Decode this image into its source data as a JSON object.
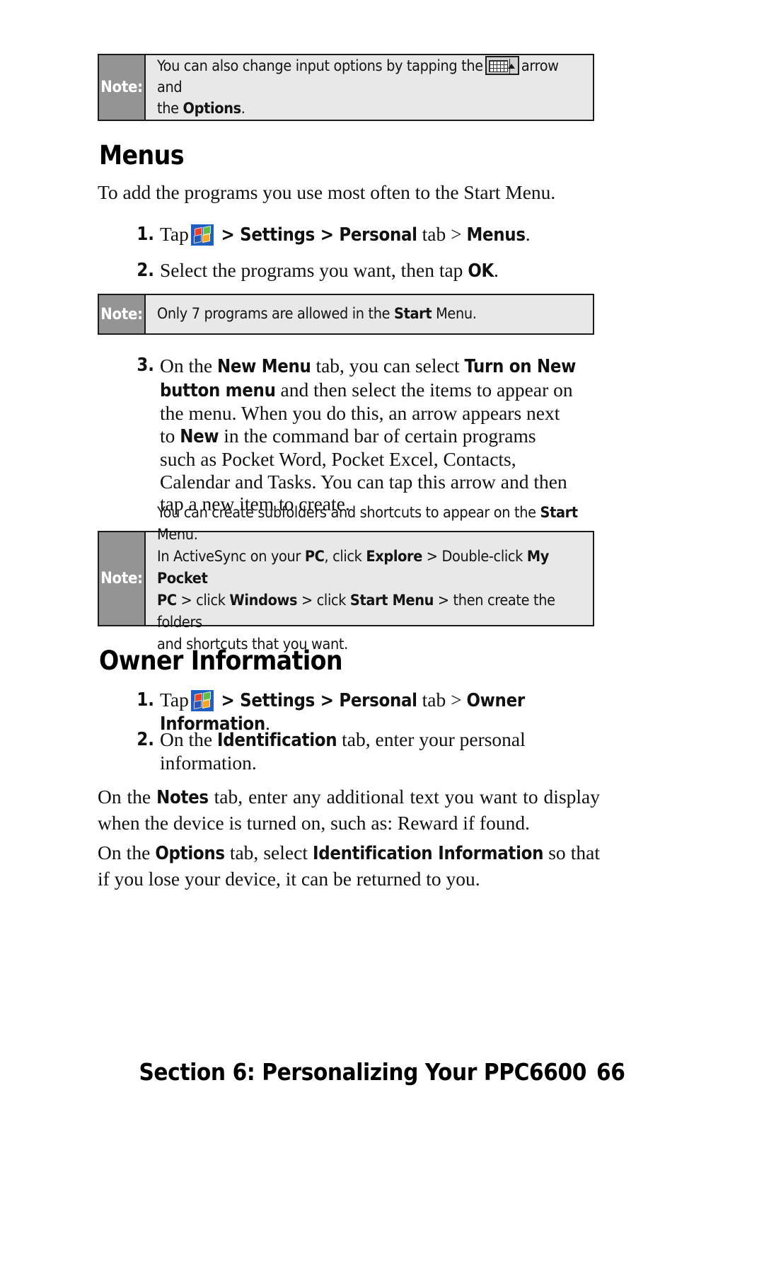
{
  "page": {
    "number": "66",
    "footer_section": "Section 6: Personalizing Your PPC6600"
  },
  "notes": {
    "label": "Note:",
    "note1": {
      "line1_before": "You can also change input options by tapping the",
      "icon": "soft-keyboard-arrow-icon",
      "line1_after": "arrow and",
      "line2_before": "the ",
      "line2_bold": "Options",
      "line2_after": "."
    },
    "note2": {
      "before": "Only 7 programs are allowed in the ",
      "bold": "Start",
      "after": " Menu."
    },
    "note3": {
      "l1a": "You can create subfolders and shortcuts to appear on the ",
      "l1b": "Start",
      "l1c": " Menu.",
      "l2a": "In ActiveSync on your ",
      "l2b": "PC",
      "l2c": ", click ",
      "l2d": "Explore",
      "l2e": " > Double-click ",
      "l2f": "My Pocket",
      "l3a": "PC",
      "l3b": " > click ",
      "l3c": "Windows",
      "l3d": " > click ",
      "l3e": "Start Menu",
      "l3f": " > then create the folders",
      "l4": "and shortcuts that you want."
    }
  },
  "sections": {
    "menus": {
      "heading": "Menus",
      "intro": "To add the programs you use most often to the Start Menu.",
      "steps": [
        {
          "num": "1.",
          "pre": "Tap",
          "icon": "windows-start-icon",
          "seg1": " > ",
          "b1": "Settings",
          "seg2": " > ",
          "b2": "Personal",
          "seg3": " tab > ",
          "b3": "Menus",
          "seg4": "."
        },
        {
          "num": "2.",
          "pre": "Select the programs you want, then tap ",
          "b1": "OK",
          "seg1": "."
        },
        {
          "num": "3.",
          "t1": "On the ",
          "b1": "New Menu",
          "t2": " tab, you can select ",
          "b2": "Turn on New",
          "b3": "button menu",
          "t3": " and then select the items to appear on",
          "t4": "the menu. When you do this, an arrow appears next",
          "t5": "to ",
          "b4": "New",
          "t6": " in the command bar of certain programs",
          "t7": "such as Pocket Word, Pocket Excel, Contacts,",
          "t8": "Calendar and Tasks. You can tap this arrow and then",
          "t9": "tap a new item to create."
        }
      ]
    },
    "owner_information": {
      "heading": "Owner Information",
      "steps": [
        {
          "num": "1.",
          "pre": "Tap",
          "icon": "windows-start-icon",
          "seg1": " > ",
          "b1": "Settings",
          "seg2": " > ",
          "b2": "Personal",
          "seg3": " tab > ",
          "b3": "Owner Information",
          "seg4": "."
        },
        {
          "num": "2.",
          "pre": "On the ",
          "b1": "Identification",
          "seg1": " tab, enter your personal",
          "seg2": "information."
        }
      ],
      "para_notes": {
        "a": "On the ",
        "b": "Notes",
        "c": " tab, enter any additional text you want to display when the device is turned on, such as: Reward if found."
      },
      "para_options": {
        "a": "On the ",
        "b": "Options",
        "c": " tab, select ",
        "d": "Identification Information",
        "e": " so that if you lose your device, it can be returned to you."
      }
    }
  },
  "colors": {
    "note_label_bg": "#949494",
    "note_body_bg": "#e8e8e8",
    "note_border": "#1a1a1a",
    "text": "#111111"
  }
}
